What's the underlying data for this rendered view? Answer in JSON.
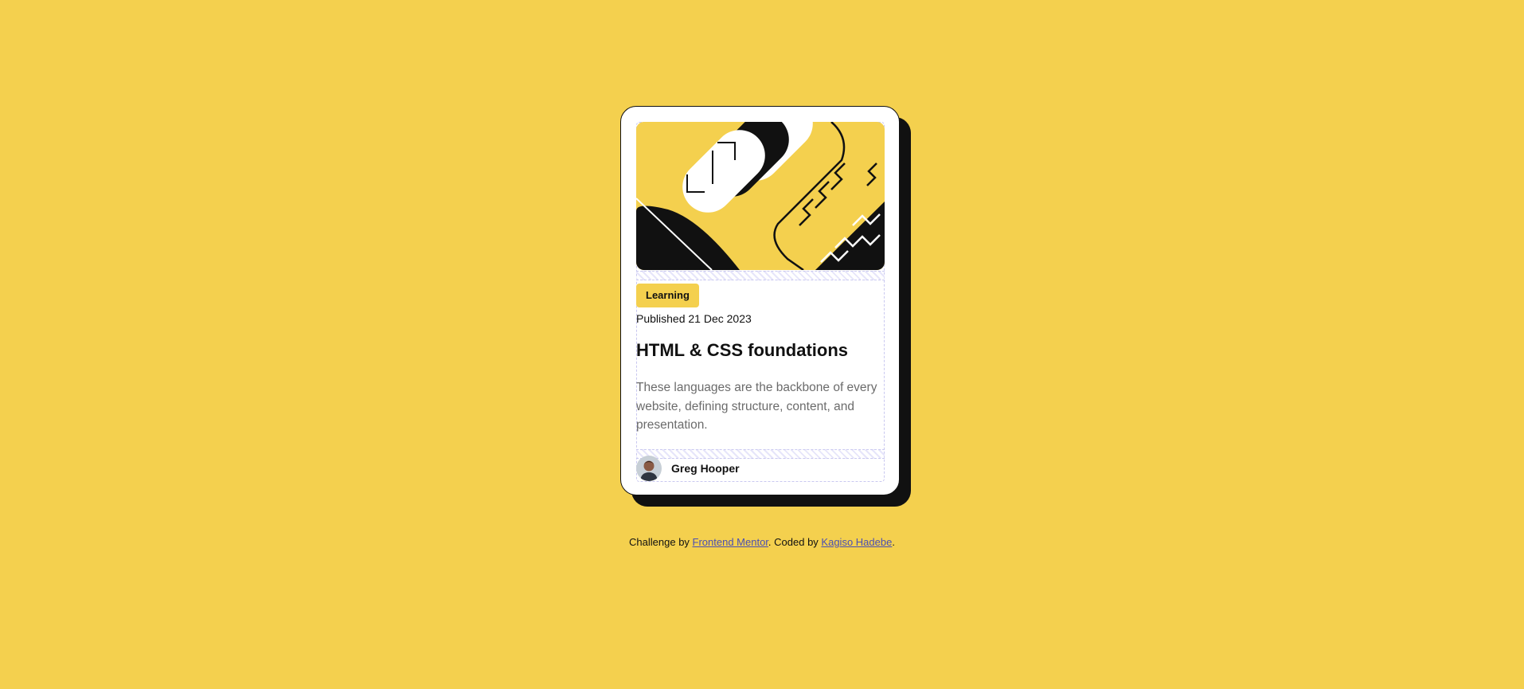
{
  "card": {
    "tag": "Learning",
    "published": "Published 21 Dec 2023",
    "title": "HTML & CSS foundations",
    "description": "These languages are the backbone of every website, defining structure, content, and presentation.",
    "author": {
      "name": "Greg Hooper"
    }
  },
  "attribution": {
    "prefix": "Challenge by ",
    "challenge_link": "Frontend Mentor",
    "middle": ". Coded by ",
    "coder_link": "Kagiso Hadebe",
    "suffix": "."
  },
  "colors": {
    "background": "#F4D04E",
    "ink": "#111111",
    "card": "#FFFFFF",
    "muted_text": "#6B6B6B",
    "link": "#4A4FB3"
  }
}
